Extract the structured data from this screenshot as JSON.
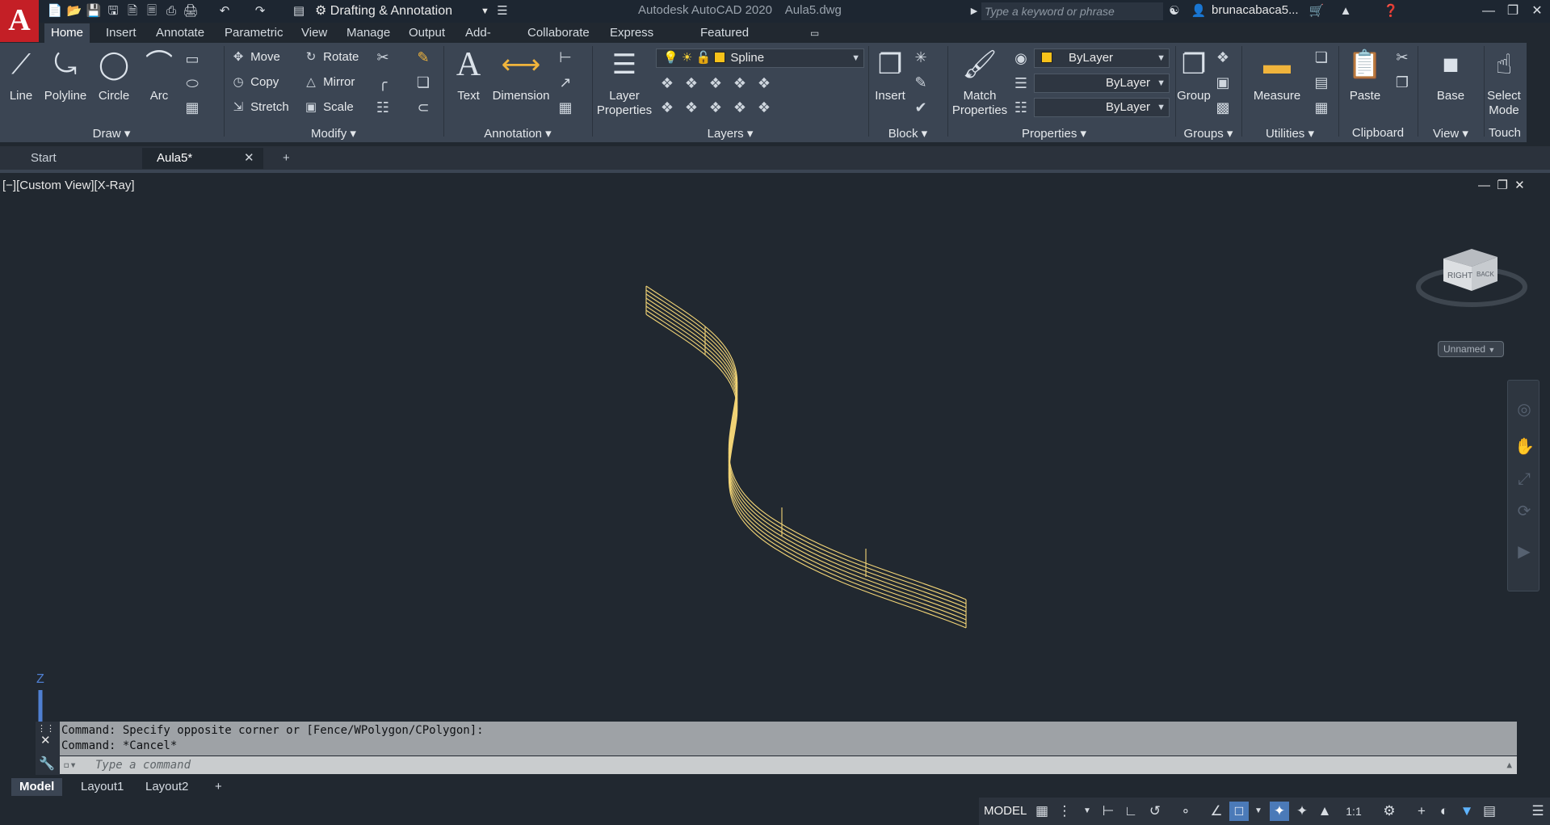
{
  "title_bar": {
    "logo_letter": "A",
    "workspace": "Drafting & Annotation",
    "app_name": "Autodesk AutoCAD 2020",
    "file_name": "Aula5.dwg",
    "search_placeholder": "Type a keyword or phrase",
    "user": "brunacabaca5...",
    "icons": [
      "new-icon",
      "open-icon",
      "save-icon",
      "save-as-icon",
      "open-web-icon",
      "save-web-icon",
      "print-icon",
      "undo-icon",
      "redo-icon",
      "workspace-gear-icon"
    ]
  },
  "ribbon_tabs": [
    "Home",
    "Insert",
    "Annotate",
    "Parametric",
    "View",
    "Manage",
    "Output",
    "Add-ins",
    "Collaborate",
    "Express Tools",
    "Featured Apps"
  ],
  "active_tab": "Home",
  "draw": {
    "label": "Draw",
    "line": "Line",
    "polyline": "Polyline",
    "circle": "Circle",
    "arc": "Arc"
  },
  "modify": {
    "label": "Modify",
    "move": "Move",
    "rotate": "Rotate",
    "copy": "Copy",
    "mirror": "Mirror",
    "stretch": "Stretch",
    "scale": "Scale"
  },
  "annotation": {
    "label": "Annotation",
    "text": "Text",
    "dimension": "Dimension"
  },
  "layers": {
    "label": "Layers",
    "layer_properties_1": "Layer",
    "layer_properties_2": "Properties",
    "current_layer": "Spline",
    "layer_color": "#f7c21a"
  },
  "block": {
    "label": "Block",
    "insert": "Insert"
  },
  "properties": {
    "label": "Properties",
    "match_1": "Match",
    "match_2": "Properties",
    "color": "ByLayer",
    "lineweight": "ByLayer",
    "linetype": "ByLayer"
  },
  "groups": {
    "label": "Groups",
    "group": "Group"
  },
  "utilities": {
    "label": "Utilities",
    "measure": "Measure"
  },
  "clipboard": {
    "label": "Clipboard",
    "paste": "Paste"
  },
  "view": {
    "label": "View",
    "base": "Base"
  },
  "touch": {
    "label": "Touch",
    "select_1": "Select",
    "select_2": "Mode"
  },
  "file_tabs": {
    "start": "Start",
    "current": "Aula5*"
  },
  "viewport": {
    "label": "[−][Custom View][X-Ray]",
    "viewcube_right": "RIGHT",
    "viewcube_back": "BACK",
    "ucs_name": "Unnamed",
    "z_axis": "Z"
  },
  "command": {
    "line1": "Command: Specify opposite corner or [Fence/WPolygon/CPolygon]:",
    "line2": "Command: *Cancel*",
    "placeholder": "Type a command"
  },
  "layout_tabs": [
    "Model",
    "Layout1",
    "Layout2"
  ],
  "status": {
    "model": "MODEL",
    "scale": "1:1"
  }
}
